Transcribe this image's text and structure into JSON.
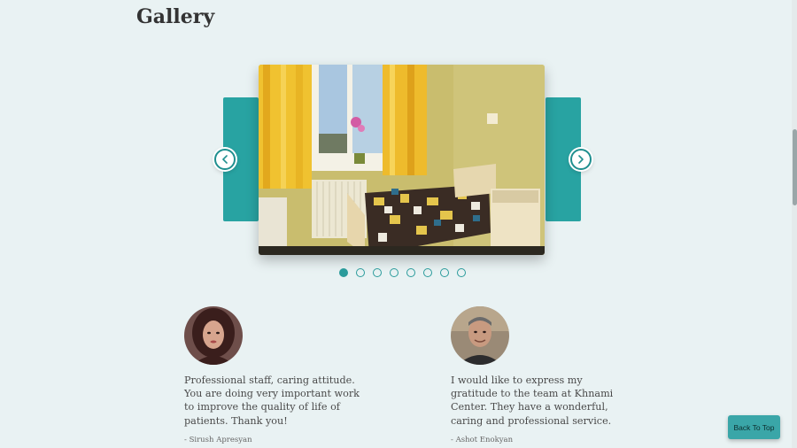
{
  "gallery": {
    "title": "Gallery",
    "slide_count": 8,
    "active_slide": 1,
    "accent_color": "#28a3a2",
    "prev_icon": "chevron-left-icon",
    "next_icon": "chevron-right-icon"
  },
  "testimonials": [
    {
      "quote": "Professional staff, caring attitude. You are doing very important work to improve the quality of life of patients. Thank you!",
      "author": "- Sirush Apresyan"
    },
    {
      "quote": "I would like to express my gratitude to the team at Khnami Center. They have a wonderful, caring and professional service.",
      "author": "- Ashot Enokyan"
    }
  ],
  "back_to_top": {
    "label": "Back To Top"
  }
}
